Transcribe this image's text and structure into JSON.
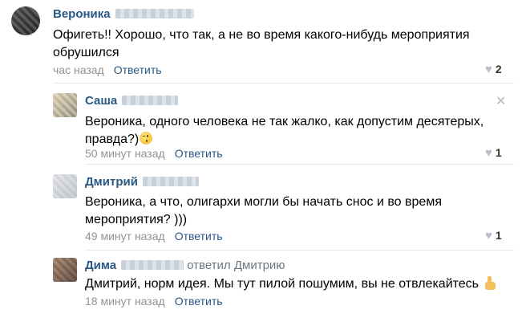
{
  "comments": [
    {
      "author": "Вероника",
      "text_lines": [
        "Офигеть!! Хорошо, что так, а не во время какого-нибудь мероприятия",
        "обрушился"
      ],
      "time": "час назад",
      "reply_label": "Ответить",
      "likes": "2"
    },
    {
      "author": "Саша",
      "text_lines": [
        "Вероника, одного человека не так жалко, как допустим десятерых,",
        "правда?)"
      ],
      "emoji": "winking-face",
      "time": "50 минут назад",
      "reply_label": "Ответить",
      "likes": "1"
    },
    {
      "author": "Дмитрий",
      "text_lines": [
        "Вероника, а что, олигархи могли бы начать снос и во время",
        "мероприятия? )))"
      ],
      "time": "49 минут назад",
      "reply_label": "Ответить",
      "likes": "1"
    },
    {
      "author": "Дима",
      "reply_to": "ответил Дмитрию",
      "text_lines": [
        "Дмитрий, норм идея. Мы тут пилой пошумим, вы не отвлекайтесь"
      ],
      "emoji": "thumbs-up",
      "time": "18 минут назад",
      "reply_label": "Ответить"
    }
  ],
  "icons": {
    "like": "heart-icon",
    "close": "close-icon"
  },
  "colors": {
    "author": "#2a5885",
    "reply_link": "#2a5885",
    "meta": "#939393",
    "divider": "#e7e8ec"
  }
}
